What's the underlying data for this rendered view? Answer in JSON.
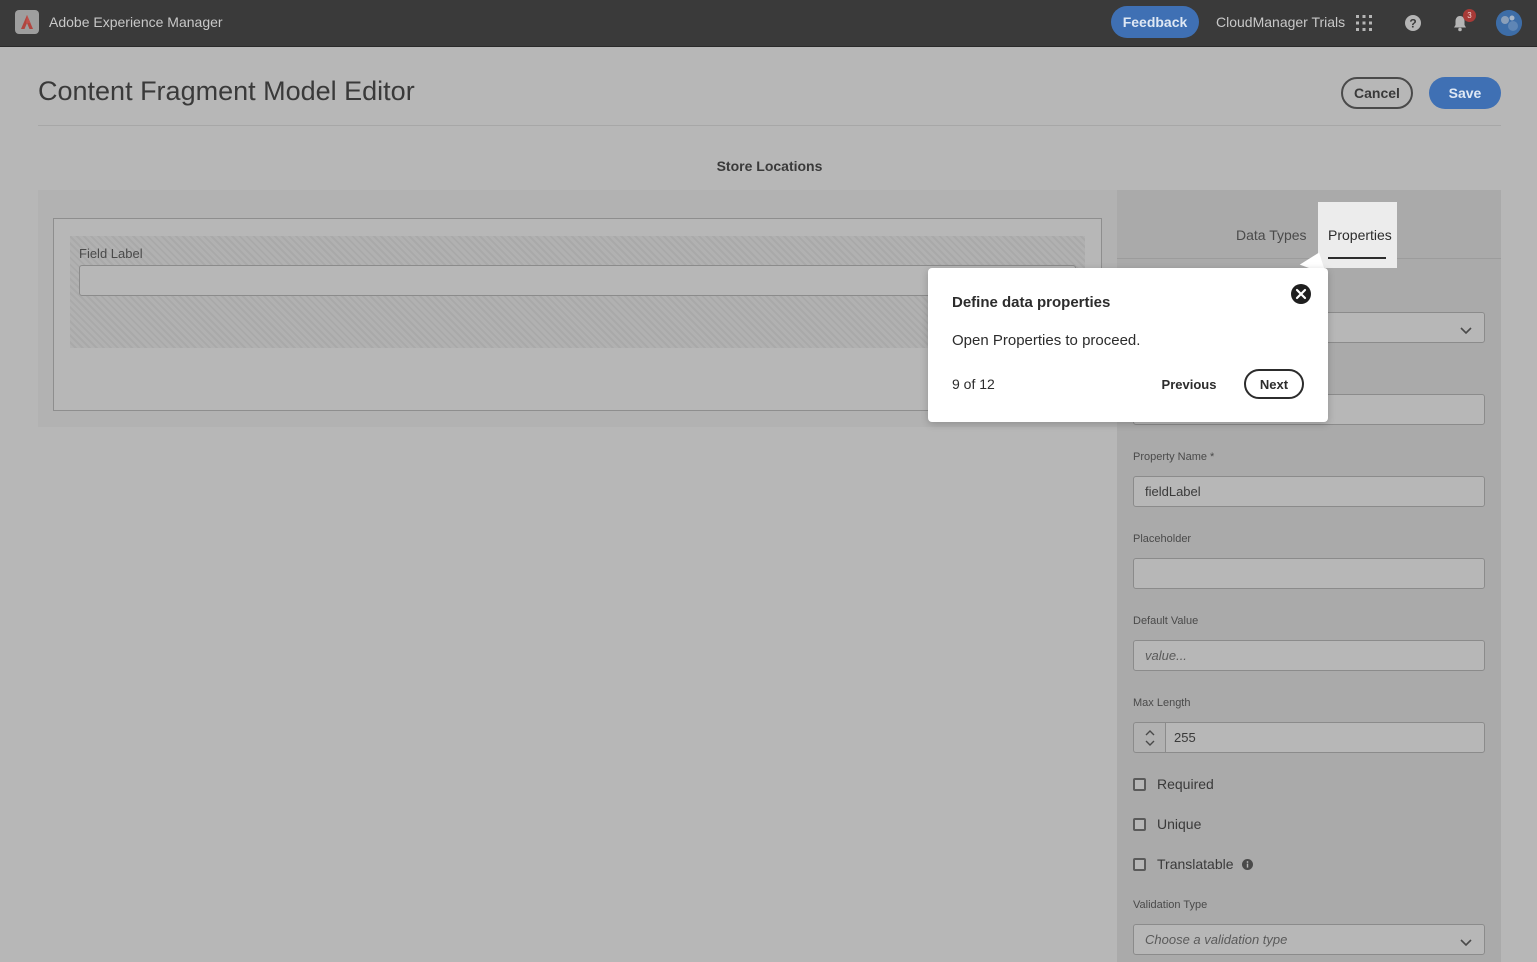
{
  "topbar": {
    "app_title": "Adobe Experience Manager",
    "feedback_label": "Feedback",
    "org_name": "CloudManager Trials",
    "notification_count": "3",
    "logo_icon": "adobe-logo-icon",
    "apps_icon": "apps-grid-icon",
    "help_icon": "help-icon",
    "bell_icon": "bell-icon"
  },
  "header": {
    "title": "Content Fragment Model Editor",
    "cancel_label": "Cancel",
    "save_label": "Save"
  },
  "model": {
    "name": "Store Locations"
  },
  "canvas": {
    "field_label": "Field Label"
  },
  "panel": {
    "tabs": [
      {
        "label": "Data Types",
        "active": false
      },
      {
        "label": "Properties",
        "active": true
      }
    ],
    "property_name": {
      "label": "Property Name *",
      "value": "fieldLabel"
    },
    "placeholder": {
      "label": "Placeholder",
      "value": ""
    },
    "default_value": {
      "label": "Default Value",
      "placeholder": "value..."
    },
    "max_length": {
      "label": "Max Length",
      "value": "255"
    },
    "checkboxes": [
      {
        "label": "Required",
        "checked": false
      },
      {
        "label": "Unique",
        "checked": false
      },
      {
        "label": "Translatable",
        "checked": false
      }
    ],
    "validation_type": {
      "label": "Validation Type",
      "placeholder": "Choose a validation type"
    }
  },
  "coachmark": {
    "title": "Define data properties",
    "body": "Open Properties to proceed.",
    "step": "9 of 12",
    "previous_label": "Previous",
    "next_label": "Next"
  },
  "colors": {
    "accent": "#3f70b4",
    "topbar": "#3a3a3a",
    "overlay_bg": "#b7b7b7",
    "badge": "#a83a37"
  }
}
